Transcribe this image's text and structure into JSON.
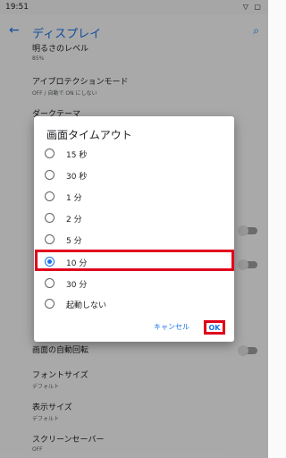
{
  "status_bar": {
    "time": "19:51",
    "icons": "▽ ▢"
  },
  "app_bar": {
    "back_icon": "←",
    "title": "ディスプレイ",
    "search_icon": "⌕"
  },
  "settings": [
    {
      "title": "明るさのレベル",
      "summary": "85%"
    },
    {
      "title": "アイプロテクションモード",
      "summary": "OFF / 自動で ON にしない"
    },
    {
      "title": "ダークテーマ",
      "summary": ""
    },
    {
      "title": "画面の自動回転",
      "summary": ""
    },
    {
      "title": "フォントサイズ",
      "summary": "デフォルト"
    },
    {
      "title": "表示サイズ",
      "summary": "デフォルト"
    },
    {
      "title": "スクリーンセーバー",
      "summary": "OFF"
    }
  ],
  "dialog": {
    "title": "画面タイムアウト",
    "options": [
      {
        "label": "15 秒",
        "selected": false
      },
      {
        "label": "30 秒",
        "selected": false
      },
      {
        "label": "1 分",
        "selected": false
      },
      {
        "label": "2 分",
        "selected": false
      },
      {
        "label": "5 分",
        "selected": false
      },
      {
        "label": "10 分",
        "selected": true
      },
      {
        "label": "30 分",
        "selected": false
      },
      {
        "label": "起動しない",
        "selected": false
      }
    ],
    "cancel_label": "キャンセル",
    "ok_label": "OK"
  },
  "colors": {
    "accent": "#1a73e8",
    "highlight": "#e0001b"
  }
}
